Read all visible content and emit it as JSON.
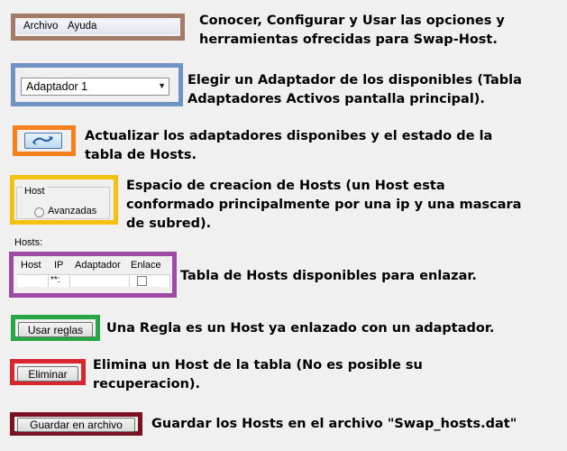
{
  "menu": {
    "items": [
      "Archivo",
      "Ayuda"
    ]
  },
  "adapter_select": {
    "value": "Adaptador 1"
  },
  "host_group": {
    "legend": "Host",
    "radio_label": "Avanzadas"
  },
  "hosts_label": "Hosts:",
  "hosts_table": {
    "columns": [
      "Host",
      "IP",
      "Adaptador",
      "Enlace"
    ],
    "ip_placeholder": "**:"
  },
  "buttons": {
    "use_rules": "Usar reglas",
    "delete": "Eliminar",
    "save": "Guardar en archivo"
  },
  "descriptions": {
    "menu": [
      "Conocer, Configurar y Usar las opciones y",
      "herramientas ofrecidas para Swap-Host."
    ],
    "adapter": [
      "Elegir un Adaptador de los disponibles (Tabla",
      "Adaptadores Activos pantalla principal)."
    ],
    "refresh": [
      "Actualizar los adaptadores disponibes y el estado de la",
      "tabla de Hosts."
    ],
    "hosts": [
      "Espacio de creacion de Hosts (un Host esta",
      "conformado principalmente por una ip y una mascara",
      "de subred)."
    ],
    "table": [
      "Tabla de Hosts disponibles para enlazar."
    ],
    "rules": [
      "Una Regla es un Host ya enlazado con un adaptador."
    ],
    "delete": [
      "Elimina un Host de la tabla (No es posible su",
      "recuperacion)."
    ],
    "save": [
      "Guardar los Hosts en el archivo \"Swap_hosts.dat\""
    ]
  },
  "colors": {
    "menu": "#a47b66",
    "adapter": "#6f93c2",
    "refresh": "#f7801e",
    "hosts": "#f5c10f",
    "table": "#9e4ca3",
    "rules": "#27a646",
    "delete": "#d7262d",
    "save": "#7b1020"
  }
}
